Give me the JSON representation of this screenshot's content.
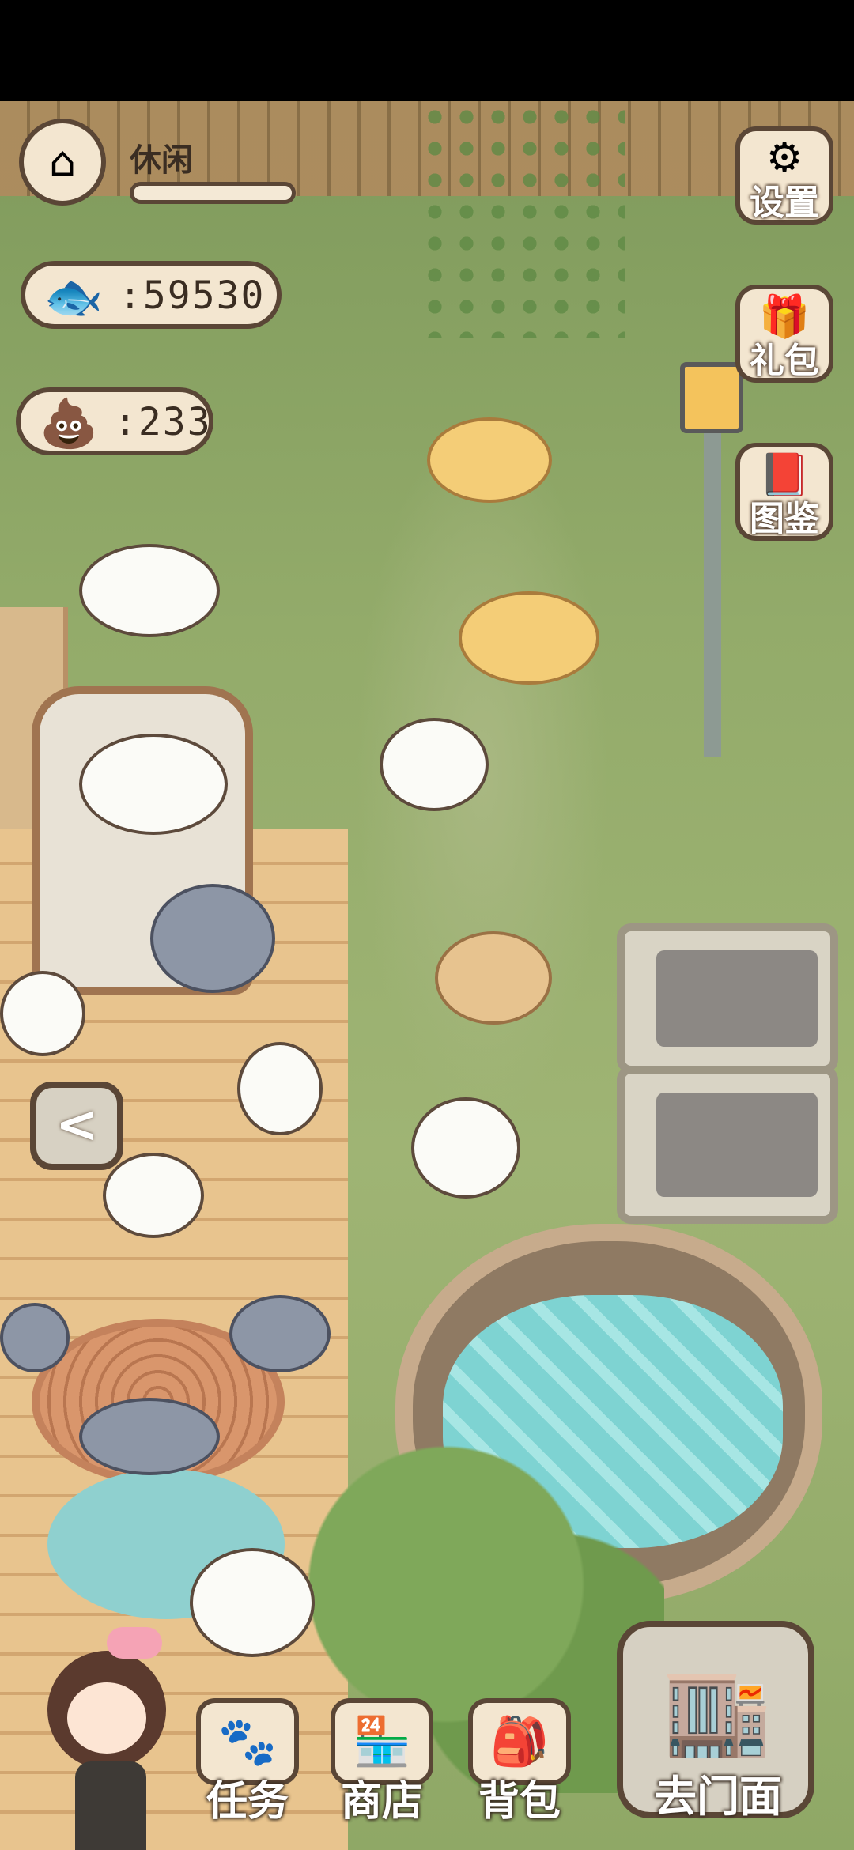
{
  "hud": {
    "home_status_label": "休闲",
    "home_progress_fraction": 0.0,
    "fish_count": ":59530",
    "poop_count": ":233"
  },
  "side_buttons": {
    "settings_label": "设置",
    "gift_label": "礼包",
    "collection_label": "图鉴"
  },
  "bottom_bar": {
    "tasks_label": "任务",
    "shop_label": "商店",
    "backpack_label": "背包",
    "storefront_label": "去门面"
  },
  "nav": {
    "back_symbol": "<"
  },
  "icons": {
    "home": "house-icon",
    "fish": "fish-icon",
    "poop": "poop-icon",
    "settings": "gear-icon",
    "gift": "gift-bag-icon",
    "collection": "book-icon",
    "tasks": "paw-task-icon",
    "shop": "shop-awning-icon",
    "backpack": "backpack-icon",
    "storefront": "storefront-icon"
  },
  "colors": {
    "panel_bg": "#f3e6d0",
    "panel_border": "#5a4636",
    "grass": "#93ab6a",
    "deck": "#e8c48e",
    "water": "#7ed3d2"
  }
}
